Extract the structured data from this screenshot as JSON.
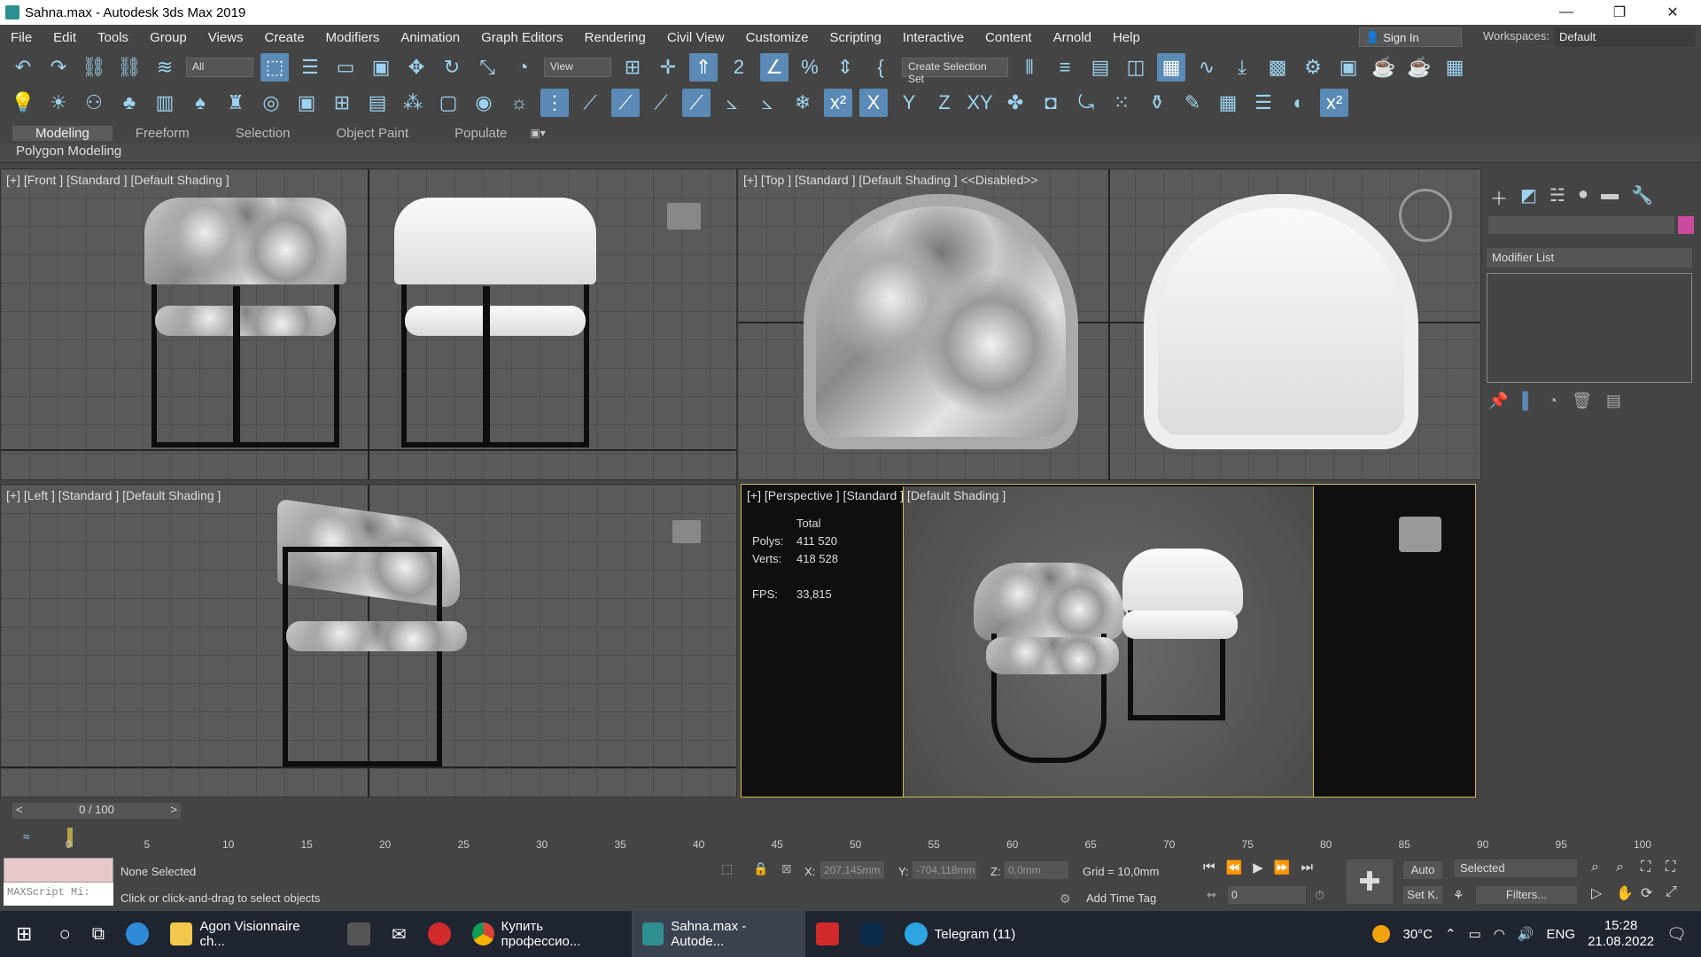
{
  "window": {
    "title": "Sahna.max - Autodesk 3ds Max 2019"
  },
  "menu": [
    "File",
    "Edit",
    "Tools",
    "Group",
    "Views",
    "Create",
    "Modifiers",
    "Animation",
    "Graph Editors",
    "Rendering",
    "Civil View",
    "Customize",
    "Scripting",
    "Interactive",
    "Content",
    "Arnold",
    "Help"
  ],
  "account": {
    "signin": "Sign In",
    "workspaces_label": "Workspaces:",
    "workspace": "Default"
  },
  "toolbar1": {
    "filter": "All",
    "refcoord": "View",
    "selset": "Create Selection Set"
  },
  "ribbon": {
    "tabs": [
      "Modeling",
      "Freeform",
      "Selection",
      "Object Paint",
      "Populate"
    ],
    "active": "Modeling",
    "panel": "Polygon Modeling"
  },
  "viewports": {
    "front": "[+] [Front ] [Standard ] [Default Shading ]",
    "top": "[+] [Top ] [Standard ] [Default Shading ] <<Disabled>>",
    "left": "[+] [Left ] [Standard ] [Default Shading ]",
    "persp": "[+] [Perspective ] [Standard ] [Default Shading ]"
  },
  "stats": {
    "total": "Total",
    "polys_label": "Polys:",
    "polys": "411 520",
    "verts_label": "Verts:",
    "verts": "418 528",
    "fps_label": "FPS:",
    "fps": "33,815"
  },
  "cmdpanel": {
    "modifier_list": "Modifier List",
    "color": "#c94a9c"
  },
  "timeline": {
    "frame": "0 / 100",
    "ticks": [
      "0",
      "5",
      "10",
      "15",
      "20",
      "25",
      "30",
      "35",
      "40",
      "45",
      "50",
      "55",
      "60",
      "65",
      "70",
      "75",
      "80",
      "85",
      "90",
      "95",
      "100"
    ]
  },
  "status": {
    "selection": "None Selected",
    "prompt": "Click or click-and-drag to select objects",
    "maxscript": "MAXScript Mi:",
    "x_label": "X:",
    "x": "207,145mm",
    "y_label": "Y:",
    "y": "-704,118mm",
    "z_label": "Z:",
    "z": "0,0mm",
    "grid": "Grid = 10,0mm",
    "addtag": "Add Time Tag",
    "auto": "Auto",
    "setk": "Set K.",
    "selected": "Selected",
    "filters": "Filters...",
    "frame": "0"
  },
  "taskbar": {
    "items": [
      "Agon Visionnaire ch...",
      "Купить профессио...",
      "Sahna.max - Autode...",
      "Telegram (11)"
    ],
    "temp": "30°C",
    "lang": "ENG",
    "time": "15:28",
    "date": "21.08.2022"
  }
}
